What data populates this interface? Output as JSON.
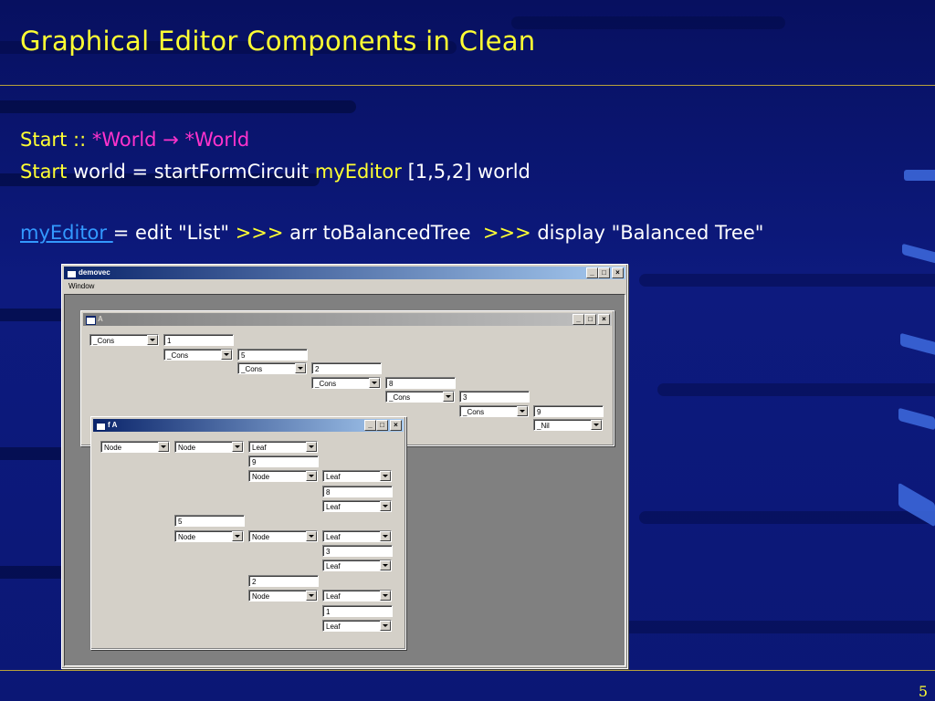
{
  "slide": {
    "title": "Graphical Editor Components in Clean",
    "page_number": "5",
    "line1": {
      "kw1": "Start",
      "sep": " :: ",
      "w1": "*World",
      "arrow": " → ",
      "w2": "*World"
    },
    "line2": {
      "kw": "Start",
      "mid": " world = startFormCircuit ",
      "editor": "myEditor",
      "tail": " [1,5,2] world"
    },
    "line3": {
      "link": "myEditor ",
      "a": "= edit \"List\" ",
      "arr1": ">>>",
      "b": " arr toBalancedTree  ",
      "arr2": ">>>",
      "c": " display \"Balanced Tree\""
    }
  },
  "main_window": {
    "title": "demovec",
    "menu": "Window",
    "buttons": {
      "minimize": "_",
      "maximize": "□",
      "close": "×"
    }
  },
  "window_a": {
    "title": "A",
    "rows": [
      {
        "combo": "_Cons",
        "value": "1"
      },
      {
        "combo": "_Cons",
        "value": "5"
      },
      {
        "combo": "_Cons",
        "value": "2"
      },
      {
        "combo": "_Cons",
        "value": "8"
      },
      {
        "combo": "_Cons",
        "value": "3"
      },
      {
        "combo": "_Cons",
        "value": "9"
      },
      {
        "combo": "_Nil"
      }
    ]
  },
  "window_fa": {
    "title": "f A",
    "items": {
      "c1": "Node",
      "c2": "Node",
      "c3": "Leaf",
      "v1": "9",
      "c4": "Node",
      "c5": "Leaf",
      "v2": "8",
      "c6": "Leaf",
      "v3": "5",
      "c7": "Node",
      "c8": "Node",
      "c9": "Leaf",
      "v4": "3",
      "c10": "Leaf",
      "v5": "2",
      "c11": "Node",
      "c12": "Leaf",
      "v6": "1",
      "c13": "Leaf"
    }
  }
}
